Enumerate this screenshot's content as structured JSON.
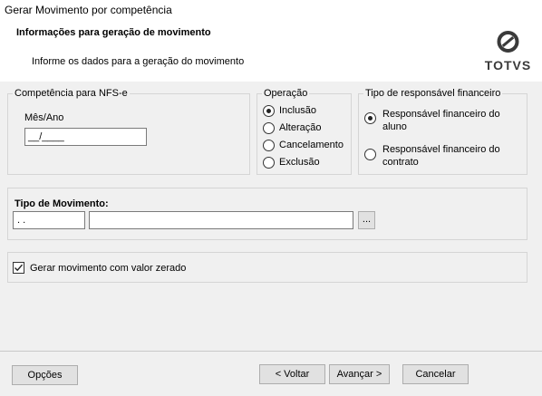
{
  "window": {
    "title": "Gerar Movimento por competência"
  },
  "header": {
    "title": "Informações para geração de movimento",
    "subtitle": "Informe os dados para a geração do movimento",
    "logo_text": "TOTVS"
  },
  "competencia": {
    "legend": "Competência para NFS-e",
    "field_label": "Mês/Ano",
    "field_value": "__/____"
  },
  "operacao": {
    "legend": "Operação",
    "options": [
      {
        "label": "Inclusão",
        "checked": true
      },
      {
        "label": "Alteração",
        "checked": false
      },
      {
        "label": "Cancelamento",
        "checked": false
      },
      {
        "label": "Exclusão",
        "checked": false
      }
    ]
  },
  "responsavel": {
    "legend": "Tipo de responsável financeiro",
    "options": [
      {
        "label": "Responsável financeiro do aluno",
        "checked": true
      },
      {
        "label": "Responsável financeiro do contrato",
        "checked": false
      }
    ]
  },
  "movimento": {
    "label": "Tipo de Movimento:",
    "code_value": ". .",
    "desc_value": "",
    "browse_label": "..."
  },
  "zerado": {
    "label": "Gerar movimento com valor zerado",
    "checked": true
  },
  "footer": {
    "options_label": "Opções",
    "back_label": "< Voltar",
    "next_label": "Avançar >",
    "cancel_label": "Cancelar"
  }
}
